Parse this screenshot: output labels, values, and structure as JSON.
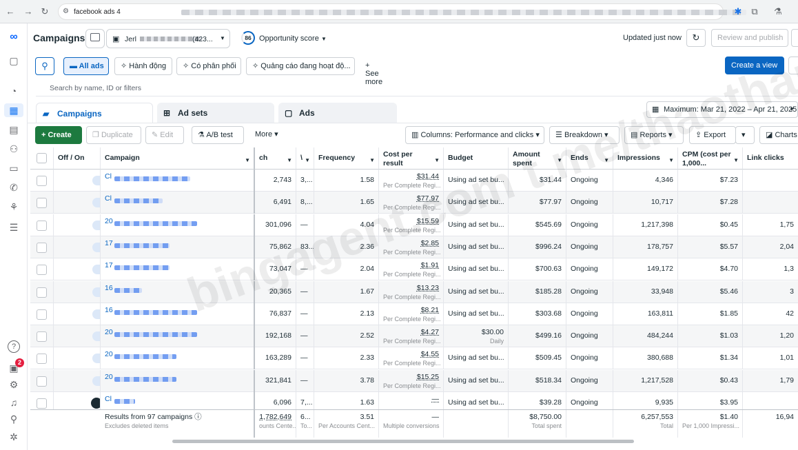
{
  "browser": {
    "tab_text": "facebook ads 4"
  },
  "header": {
    "title": "Campaigns",
    "account_name": "Jerl",
    "account_id": "(423...",
    "score_value": "86",
    "score_label": "Opportunity score",
    "updated": "Updated just now",
    "review_label": "Review and publish"
  },
  "filters": {
    "all_ads": "All ads",
    "chip1": "Hành động",
    "chip2": "Có phân phối",
    "chip3": "Quảng cáo đang hoạt độ...",
    "see_more": "See more",
    "create_view": "Create a view",
    "search_placeholder": "Search by name, ID or filters"
  },
  "tabs": [
    {
      "label": "Campaigns"
    },
    {
      "label": "Ad sets"
    },
    {
      "label": "Ads"
    }
  ],
  "date_range": "Maximum: Mar 21, 2022 – Apr 21, 2025",
  "toolbar": {
    "create": "Create",
    "duplicate": "Duplicate",
    "edit": "Edit",
    "ab_test": "A/B test",
    "more": "More",
    "columns": "Columns: Performance and clicks",
    "breakdown": "Breakdown",
    "reports": "Reports",
    "export": "Export",
    "charts": "Charts"
  },
  "columns": {
    "offon": "Off / On",
    "campaign": "Campaign",
    "reach": "ch",
    "impr_short": "\\",
    "frequency": "Frequency",
    "cost_per_result": "Cost per result",
    "budget": "Budget",
    "amount_spent": "Amount spent",
    "ends": "Ends",
    "impressions": "Impressions",
    "cpm": "CPM (cost per 1,000...",
    "link_clicks": "Link clicks"
  },
  "rows": [
    {
      "name": "Cl",
      "on": true,
      "reach": "2,743",
      "col2": "3,...",
      "freq": "1.58",
      "cpr": "$31.44",
      "cpr_sub": "Per Complete Regi...",
      "budget": "Using ad set bu...",
      "budget_sub": "",
      "spent": "$31.44",
      "ends": "Ongoing",
      "impr": "4,346",
      "cpm": "$7.23",
      "link": ""
    },
    {
      "name": "Cl",
      "on": true,
      "reach": "6,491",
      "col2": "8,...",
      "freq": "1.65",
      "cpr": "$77.97",
      "cpr_sub": "Per Complete Regi...",
      "budget": "Using ad set bu...",
      "budget_sub": "",
      "spent": "$77.97",
      "ends": "Ongoing",
      "impr": "10,717",
      "cpm": "$7.28",
      "link": ""
    },
    {
      "name": "20",
      "on": true,
      "reach": "301,096",
      "col2": "—",
      "freq": "4.04",
      "cpr": "$15.59",
      "cpr_sub": "Per Complete Regi...",
      "budget": "Using ad set bu...",
      "budget_sub": "",
      "spent": "$545.69",
      "ends": "Ongoing",
      "impr": "1,217,398",
      "cpm": "$0.45",
      "link": "1,75"
    },
    {
      "name": "17",
      "on": true,
      "reach": "75,862",
      "col2": "83...",
      "freq": "2.36",
      "cpr": "$2.85",
      "cpr_sub": "Per Complete Regi...",
      "budget": "Using ad set bu...",
      "budget_sub": "",
      "spent": "$996.24",
      "ends": "Ongoing",
      "impr": "178,757",
      "cpm": "$5.57",
      "link": "2,04"
    },
    {
      "name": "17",
      "on": true,
      "reach": "73,047",
      "col2": "—",
      "freq": "2.04",
      "cpr": "$1.91",
      "cpr_sub": "Per Complete Regi...",
      "budget": "Using ad set bu...",
      "budget_sub": "",
      "spent": "$700.63",
      "ends": "Ongoing",
      "impr": "149,172",
      "cpm": "$4.70",
      "link": "1,3"
    },
    {
      "name": "16",
      "on": true,
      "reach": "20,365",
      "col2": "—",
      "freq": "1.67",
      "cpr": "$13.23",
      "cpr_sub": "Per Complete Regi...",
      "budget": "Using ad set bu...",
      "budget_sub": "",
      "spent": "$185.28",
      "ends": "Ongoing",
      "impr": "33,948",
      "cpm": "$5.46",
      "link": "3"
    },
    {
      "name": "16",
      "on": true,
      "reach": "76,837",
      "col2": "—",
      "freq": "2.13",
      "cpr": "$8.21",
      "cpr_sub": "Per Complete Regi...",
      "budget": "Using ad set bu...",
      "budget_sub": "",
      "spent": "$303.68",
      "ends": "Ongoing",
      "impr": "163,811",
      "cpm": "$1.85",
      "link": "42"
    },
    {
      "name": "20",
      "on": true,
      "reach": "192,168",
      "col2": "—",
      "freq": "2.52",
      "cpr": "$4.27",
      "cpr_sub": "Per Complete Regi...",
      "budget": "$30.00",
      "budget_sub": "Daily",
      "spent": "$499.16",
      "ends": "Ongoing",
      "impr": "484,244",
      "cpm": "$1.03",
      "link": "1,20"
    },
    {
      "name": "20",
      "on": true,
      "reach": "163,289",
      "col2": "—",
      "freq": "2.33",
      "cpr": "$4.55",
      "cpr_sub": "Per Complete Regi...",
      "budget": "Using ad set bu...",
      "budget_sub": "",
      "spent": "$509.45",
      "ends": "Ongoing",
      "impr": "380,688",
      "cpm": "$1.34",
      "link": "1,01"
    },
    {
      "name": "20",
      "on": true,
      "reach": "321,841",
      "col2": "—",
      "freq": "3.78",
      "cpr": "$15.25",
      "cpr_sub": "Per Complete Regi...",
      "budget": "Using ad set bu...",
      "budget_sub": "",
      "spent": "$518.34",
      "ends": "Ongoing",
      "impr": "1,217,528",
      "cpm": "$0.43",
      "link": "1,79"
    },
    {
      "name": "Cl",
      "on": false,
      "reach": "6,096",
      "col2": "7,...",
      "freq": "1.63",
      "cpr": "—",
      "cpr_sub": "",
      "budget": "Using ad set bu...",
      "budget_sub": "",
      "spent": "$39.28",
      "ends": "Ongoing",
      "impr": "9,935",
      "cpm": "$3.95",
      "link": ""
    }
  ],
  "footer": {
    "results": "Results from 97 campaigns",
    "excludes": "Excludes deleted items",
    "reach": "1,782,649",
    "reach_sub": "ounts Cente...",
    "col2": "6...",
    "col2_sub": "To...",
    "freq": "3.51",
    "freq_sub": "Per Accounts Cent...",
    "cpr": "—",
    "cpr_sub": "Multiple conversions",
    "spent": "$8,750.00",
    "spent_sub": "Total spent",
    "impr": "6,257,553",
    "impr_sub": "Total",
    "cpm": "$1.40",
    "cpm_sub": "Per 1,000 Impressi...",
    "link": "16,94"
  },
  "watermark": "bingagent.com t.me/thaothanh6609",
  "colors": {
    "accent": "#0a66c2",
    "create": "#1d7a3f",
    "badge": "#e41e3f"
  },
  "notifications_count": "2"
}
